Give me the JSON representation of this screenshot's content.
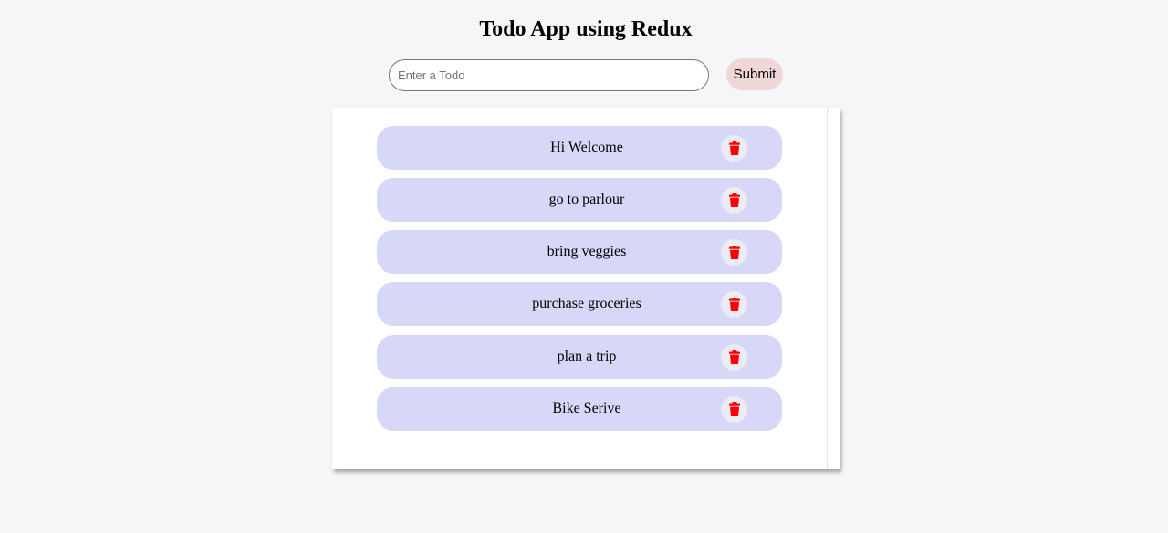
{
  "header": {
    "title": "Todo App using Redux"
  },
  "form": {
    "input_placeholder": "Enter a Todo",
    "input_value": "",
    "submit_label": "Submit"
  },
  "todos": [
    {
      "text": "Hi Welcome",
      "delete_icon": "trash-icon"
    },
    {
      "text": "go to parlour",
      "delete_icon": "trash-icon"
    },
    {
      "text": "bring veggies",
      "delete_icon": "trash-icon"
    },
    {
      "text": "purchase groceries",
      "delete_icon": "trash-icon"
    },
    {
      "text": "plan a trip",
      "delete_icon": "trash-icon"
    },
    {
      "text": "Bike Serive",
      "delete_icon": "trash-icon"
    }
  ],
  "colors": {
    "page_background": "#f5f6f8",
    "todo_background": "#d7d7f7",
    "submit_background": "#f0d6d6",
    "delete_icon": "#ff0000"
  }
}
